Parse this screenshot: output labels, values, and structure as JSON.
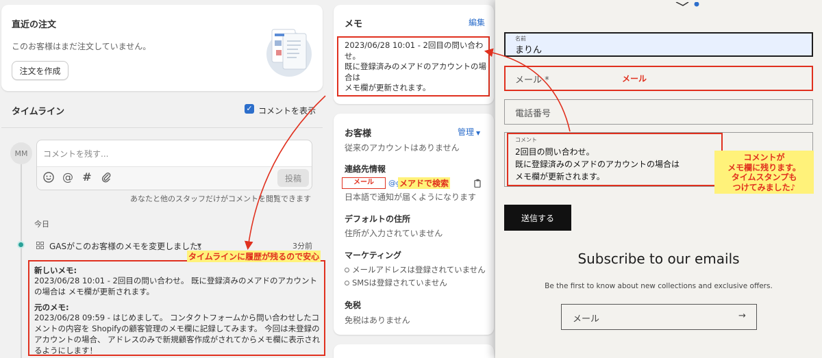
{
  "recent_orders": {
    "title": "直近の注文",
    "empty_text": "このお客様はまだ注文していません。",
    "create_button": "注文を作成"
  },
  "timeline": {
    "title": "タイムライン",
    "show_comments_label": "コメントを表示",
    "avatar_initials": "MM",
    "comment_placeholder": "コメントを残す...",
    "post_button": "投稿",
    "visibility_note": "あなたと他のスタッフだけがコメントを閲覧できます",
    "today_label": "今日",
    "event_text": "GASがこのお客様のメモを変更しました。",
    "event_time": "3分前",
    "new_memo_label": "新しいメモ:",
    "new_memo_body": "2023/06/28 10:01 - 2回目の問い合わせ。 既に登録済みのメアドのアカウントの場合は メモ欄が更新されます。",
    "old_memo_label": "元のメモ:",
    "old_memo_body": "2023/06/28 09:59 - はじめまして。 コンタクトフォームから問い合わせしたコメントの内容を Shopifyの顧客管理のメモ欄に記録してみます。 今回は未登録のアカウントの場合、 アドレスのみで新規顧客作成がされてからメモ欄に表示されるようにします！"
  },
  "memo": {
    "title": "メモ",
    "edit_link": "編集",
    "lines": [
      "2023/06/28 10:01 - 2回目の問い合わ",
      "せ。",
      "既に登録済みのメアドのアカウントの場",
      "合は",
      "メモ欄が更新されます。"
    ]
  },
  "customer": {
    "title": "お客様",
    "manage_link": "管理",
    "no_accounts": "従来のアカウントはありません",
    "contact_title": "連絡先情報",
    "email_redacted": "メール",
    "email_suffix": "@g",
    "notify_text": "日本語で通知が届くようになります",
    "address_title": "デフォルトの住所",
    "address_text": "住所が入力されていません",
    "marketing_title": "マーケティング",
    "marketing_items": [
      "メールアドレスは登録されていません",
      "SMSは登録されていません"
    ],
    "tax_title": "免税",
    "tax_text": "免税はありません"
  },
  "contact_form": {
    "name_label": "名前",
    "name_value": "まりん",
    "email_placeholder": "メール *",
    "email_redacted": "メール",
    "phone_placeholder": "電話番号",
    "comment_label": "コメント",
    "comment_lines": [
      "2回目の問い合わせ。",
      "既に登録済みのメアドのアカウントの場合は",
      "メモ欄が更新されます。"
    ],
    "submit_button": "送信する",
    "subscribe_title": "Subscribe to our emails",
    "subscribe_sub": "Be the first to know about new collections and exclusive offers.",
    "subscribe_placeholder": "メール",
    "subscribe_arrow": "→"
  },
  "annotations": {
    "search_by_email": "メアドで検索",
    "history_note": "タイムラインに履歴が残るので安心",
    "comment_note": [
      "コメントが",
      "メモ欄に残ります。",
      "タイムスタンプも",
      "つけてみました♪"
    ]
  },
  "colors": {
    "accent_red": "#e0301e",
    "highlight_yellow": "#fff27a",
    "link_blue": "#2c6ecb",
    "name_field_bg": "#e8f0fe",
    "storefront_bg": "#f3f2ee"
  }
}
